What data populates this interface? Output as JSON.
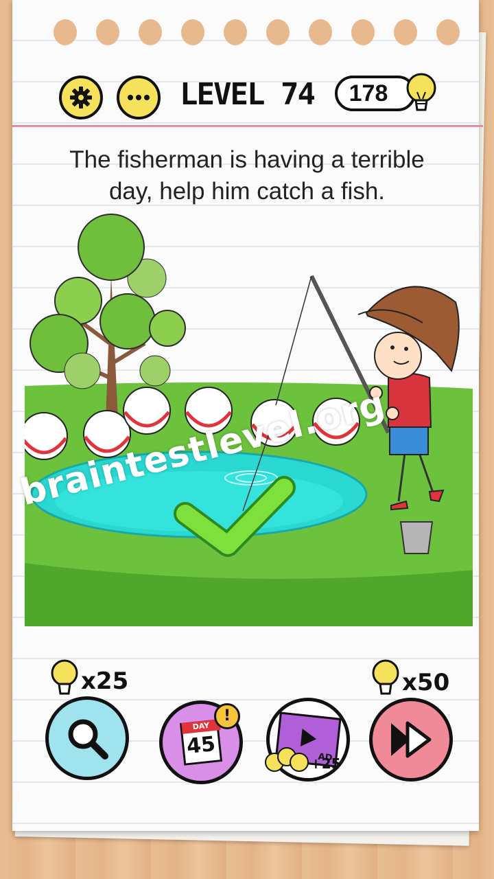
{
  "header": {
    "level_label": "LEVEL 74",
    "hint_count": "178",
    "settings_icon": "gear-icon",
    "menu_icon": "more-icon",
    "hint_icon": "lightbulb-icon"
  },
  "question": {
    "line1": "The fisherman is having a terrible",
    "line2": "day, help him catch a fish."
  },
  "watermark": "braintestlevel.org",
  "bottom_bar": {
    "hint_cost": "x25",
    "skip_cost": "x50",
    "calendar_tag": "DAY",
    "calendar_day": "45",
    "calendar_alert": "!",
    "video_label": "AD",
    "video_reward": "+25"
  },
  "colors": {
    "accent_yellow": "#f6e15a",
    "grass": "#6cc23d",
    "pond": "#29d8d0",
    "check_green": "#7ee03a",
    "hint_button": "#9fe3ee",
    "calendar_button": "#d98fe8",
    "skip_button": "#f08a98"
  }
}
